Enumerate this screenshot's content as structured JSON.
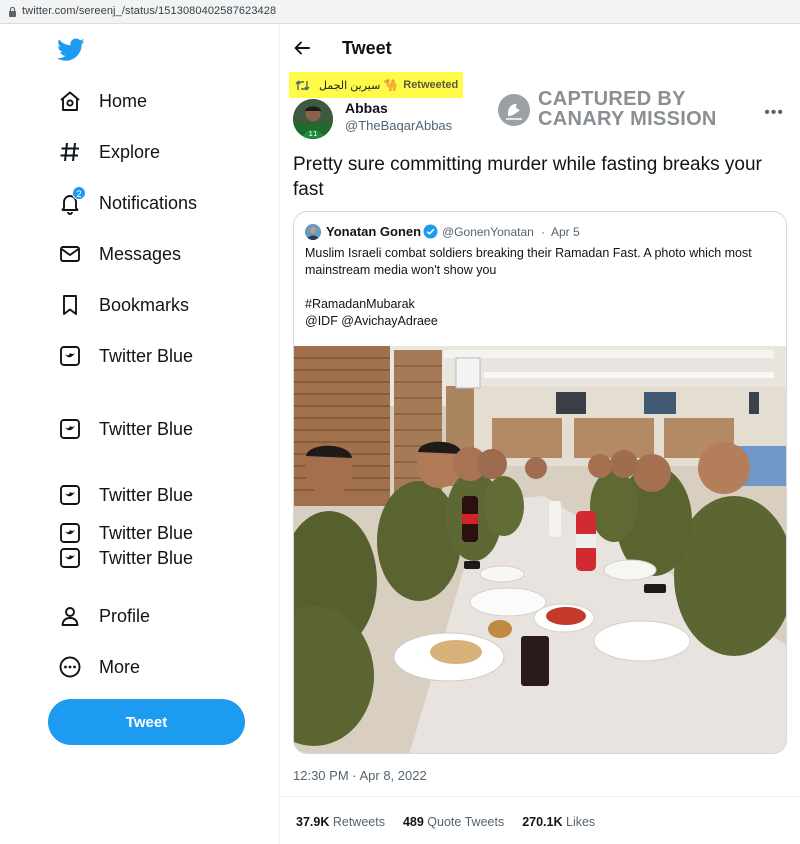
{
  "browser": {
    "url": "twitter.com/sereenj_/status/1513080402587623428"
  },
  "sidebar": {
    "items": [
      {
        "label": "Home",
        "icon": "home-icon"
      },
      {
        "label": "Explore",
        "icon": "hashtag-icon"
      },
      {
        "label": "Notifications",
        "icon": "bell-icon",
        "badge": "2"
      },
      {
        "label": "Messages",
        "icon": "envelope-icon"
      },
      {
        "label": "Bookmarks",
        "icon": "bookmark-icon"
      },
      {
        "label": "Twitter Blue",
        "icon": "twitter-blue-icon"
      },
      {
        "label": "Twitter Blue",
        "icon": "twitter-blue-icon"
      },
      {
        "label": "Twitter Blue",
        "icon": "twitter-blue-icon"
      },
      {
        "label": "Twitter Blue",
        "icon": "twitter-blue-icon"
      },
      {
        "label": "Twitter Blue",
        "icon": "twitter-blue-icon"
      },
      {
        "label": "Profile",
        "icon": "person-icon"
      },
      {
        "label": "More",
        "icon": "more-circle-icon"
      }
    ],
    "tweet_button": "Tweet"
  },
  "header": {
    "title": "Tweet"
  },
  "retweet_banner": {
    "user": "سيرين الجمل",
    "label": "Retweeted",
    "highlight_color": "#fffb48"
  },
  "watermark": {
    "line1": "CAPTURED BY",
    "line2": "CANARY MISSION"
  },
  "tweet": {
    "author_name": "Abbas",
    "author_handle": "@TheBaqarAbbas",
    "text": "Pretty sure committing murder while fasting breaks your fast",
    "timestamp": "12:30 PM · Apr 8, 2022",
    "stats": {
      "retweets_count": "37.9K",
      "retweets_label": "Retweets",
      "quotes_count": "489",
      "quotes_label": "Quote Tweets",
      "likes_count": "270.1K",
      "likes_label": "Likes"
    }
  },
  "quoted_tweet": {
    "author_name": "Yonatan Gonen",
    "author_handle": "@GonenYonatan",
    "separator": "·",
    "date": "Apr 5",
    "text": "Muslim Israeli combat soldiers breaking their Ramadan Fast. A photo which most mainstream media won't show you",
    "hashtag": "#RamadanMubarak",
    "mentions": "@IDF @AvichayAdraee",
    "photo": "soldiers-dinner-photo"
  },
  "colors": {
    "accent": "#1d9bf0",
    "text": "#0f1419",
    "muted": "#536471"
  }
}
